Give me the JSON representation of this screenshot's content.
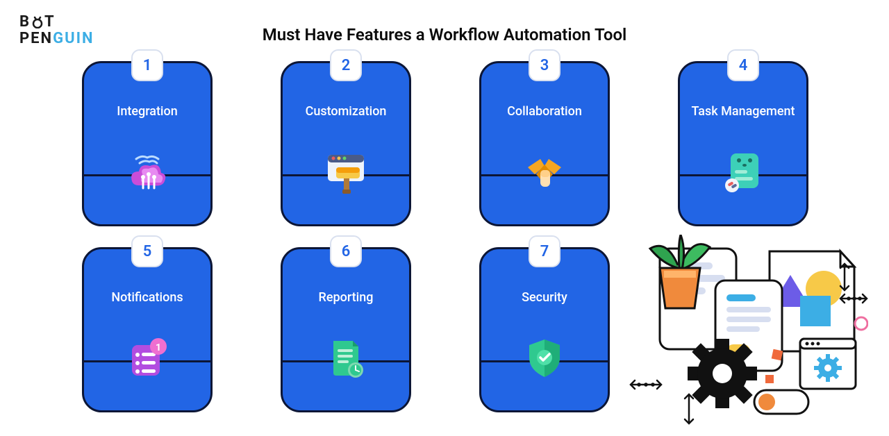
{
  "brand": {
    "line1_a": "B",
    "line1_b": "T",
    "line2_a": "PEN",
    "line2_b": "GUIN"
  },
  "title": "Must Have Features a Workflow Automation Tool",
  "cards": [
    {
      "num": "1",
      "label": "Integration",
      "icon": "cloud-wifi-icon"
    },
    {
      "num": "2",
      "label": "Customization",
      "icon": "window-paint-icon"
    },
    {
      "num": "3",
      "label": "Collaboration",
      "icon": "handshake-icon"
    },
    {
      "num": "4",
      "label": "Task Management",
      "icon": "task-board-icon"
    },
    {
      "num": "5",
      "label": "Notifications",
      "icon": "list-badge-icon"
    },
    {
      "num": "6",
      "label": "Reporting",
      "icon": "report-clock-icon"
    },
    {
      "num": "7",
      "label": "Security",
      "icon": "shield-check-icon"
    }
  ]
}
